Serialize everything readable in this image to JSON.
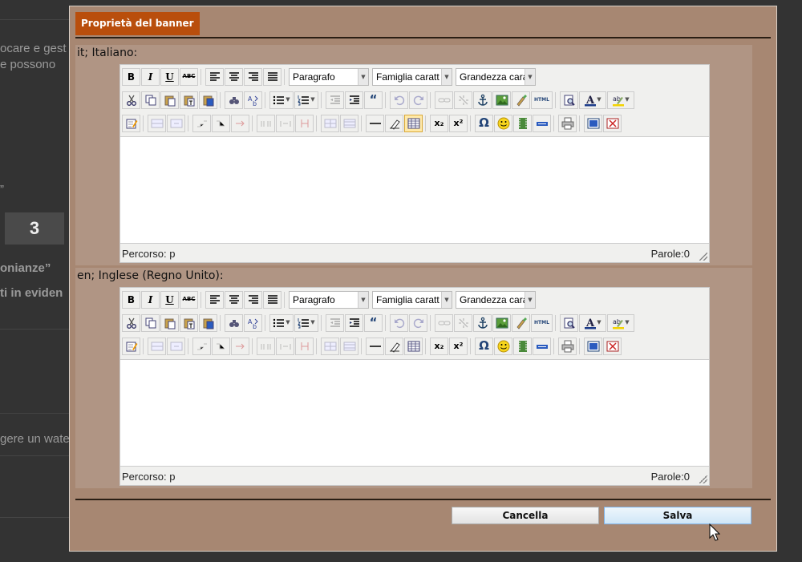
{
  "background": {
    "texts": [
      "ocare e gest",
      "e possono",
      "”",
      "onianze”",
      "ti in eviden",
      "gere un wate"
    ],
    "counter_value": "3"
  },
  "dialog": {
    "title": "Proprietà del banner",
    "languages": [
      {
        "label": "it; Italiano:"
      },
      {
        "label": "en; Inglese (Regno Unito):"
      }
    ],
    "editor": {
      "toolbar": {
        "paragraph_select": "Paragrafo",
        "font_family_select": "Famiglia caratt",
        "font_size_select": "Grandezza cara",
        "bold": "B",
        "italic": "I",
        "underline": "U",
        "strikethrough": "ABC",
        "blockquote": "“",
        "html": "HTML",
        "subscript": "x₂",
        "superscript": "x²",
        "special_char": "Ω"
      },
      "path_label": "Percorso: p",
      "word_count": "Parole:0"
    },
    "buttons": {
      "cancel": "Cancella",
      "save": "Salva"
    }
  },
  "colors": {
    "dialog_bg": "#a78772",
    "title_tab": "#b94e0c",
    "save_border": "#7eb4ea"
  }
}
